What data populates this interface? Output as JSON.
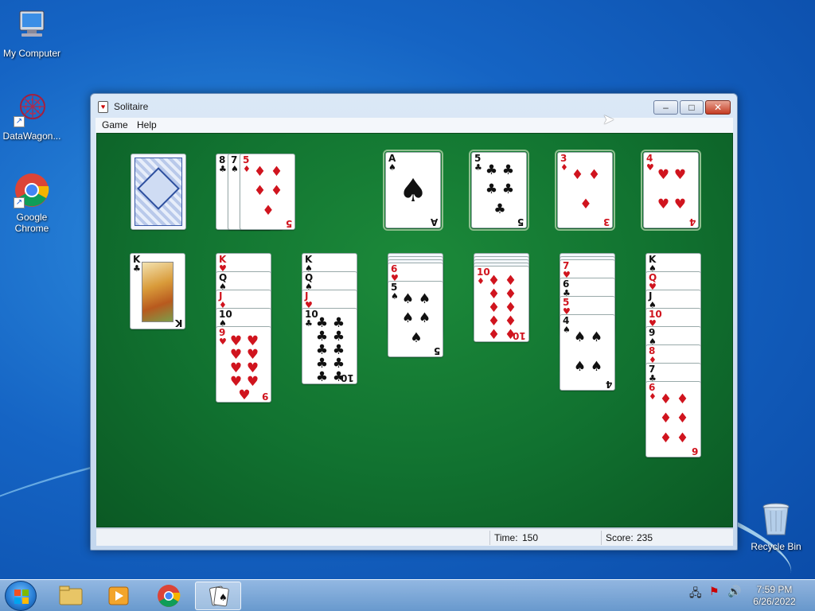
{
  "desktop": {
    "icons": [
      {
        "label": "My Computer"
      },
      {
        "label": "DataWagon..."
      },
      {
        "label": "Google Chrome"
      },
      {
        "label": "Recycle Bin"
      }
    ]
  },
  "window": {
    "title": "Solitaire",
    "menu": [
      "Game",
      "Help"
    ],
    "buttons": {
      "minimize": "–",
      "maximize": "□",
      "close": "✕"
    }
  },
  "game": {
    "stock": "card-back",
    "waste": [
      {
        "rank": "8",
        "suit": "♣",
        "color": "black"
      },
      {
        "rank": "7",
        "suit": "♠",
        "color": "black"
      },
      {
        "rank": "5",
        "suit": "♦",
        "color": "red"
      }
    ],
    "foundations": [
      {
        "rank": "A",
        "suit": "♠",
        "color": "black"
      },
      {
        "rank": "5",
        "suit": "♣",
        "color": "black"
      },
      {
        "rank": "3",
        "suit": "♦",
        "color": "red"
      },
      {
        "rank": "4",
        "suit": "♥",
        "color": "red"
      }
    ],
    "tableau": [
      [
        {
          "rank": "K",
          "suit": "♣",
          "color": "black"
        }
      ],
      [
        {
          "rank": "K",
          "suit": "♥",
          "color": "red"
        },
        {
          "rank": "Q",
          "suit": "♠",
          "color": "black"
        },
        {
          "rank": "J",
          "suit": "♦",
          "color": "red"
        },
        {
          "rank": "10",
          "suit": "♠",
          "color": "black"
        },
        {
          "rank": "9",
          "suit": "♥",
          "color": "red"
        }
      ],
      [
        {
          "rank": "K",
          "suit": "♠",
          "color": "black"
        },
        {
          "rank": "Q",
          "suit": "♠",
          "color": "black"
        },
        {
          "rank": "J",
          "suit": "♥",
          "color": "red"
        },
        {
          "rank": "10",
          "suit": "♣",
          "color": "black"
        }
      ],
      [
        {
          "rank": "6",
          "suit": "♥",
          "color": "red"
        },
        {
          "rank": "5",
          "suit": "♠",
          "color": "black"
        }
      ],
      [
        {
          "rank": "10",
          "suit": "♦",
          "color": "red"
        }
      ],
      [
        {
          "rank": "7",
          "suit": "♥",
          "color": "red"
        },
        {
          "rank": "6",
          "suit": "♣",
          "color": "black"
        },
        {
          "rank": "5",
          "suit": "♥",
          "color": "red"
        },
        {
          "rank": "4",
          "suit": "♠",
          "color": "black"
        }
      ],
      [
        {
          "rank": "K",
          "suit": "♠",
          "color": "black"
        },
        {
          "rank": "Q",
          "suit": "♥",
          "color": "red"
        },
        {
          "rank": "J",
          "suit": "♠",
          "color": "black"
        },
        {
          "rank": "10",
          "suit": "♥",
          "color": "red"
        },
        {
          "rank": "9",
          "suit": "♠",
          "color": "black"
        },
        {
          "rank": "8",
          "suit": "♦",
          "color": "red"
        },
        {
          "rank": "7",
          "suit": "♣",
          "color": "black"
        },
        {
          "rank": "6",
          "suit": "♦",
          "color": "red"
        }
      ]
    ],
    "hidden_counts": [
      0,
      0,
      0,
      3,
      4,
      2,
      0
    ]
  },
  "status": {
    "time_label": "Time:",
    "time_value": "150",
    "score_label": "Score:",
    "score_value": "235"
  },
  "taskbar": {
    "clock_time": "7:59 PM",
    "clock_date": "6/26/2022"
  }
}
